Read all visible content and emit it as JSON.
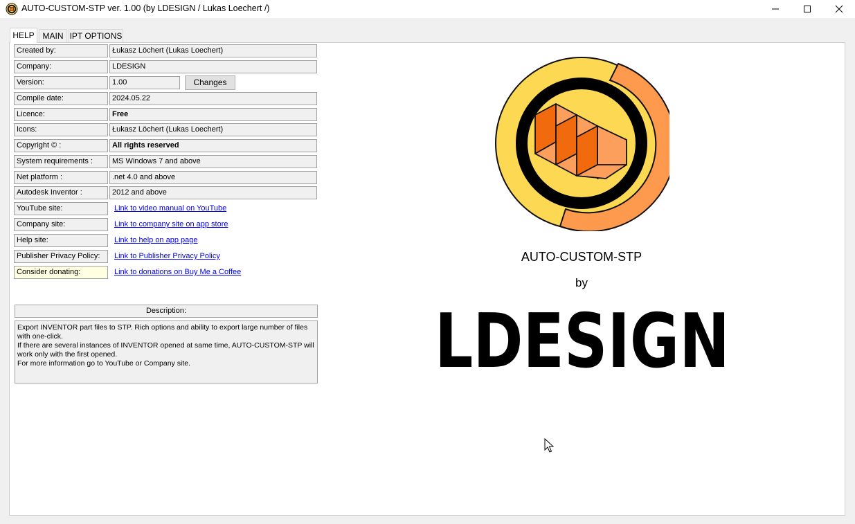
{
  "window": {
    "title": "AUTO-CUSTOM-STP ver. 1.00 (by LDESIGN / Lukas Loechert /)"
  },
  "tabs": [
    {
      "label": "HELP",
      "active": true
    },
    {
      "label": "MAIN",
      "active": false
    },
    {
      "label": "IPT OPTIONS",
      "active": false
    }
  ],
  "info": {
    "created_by": {
      "label": "Created by:",
      "value": "Łukasz Löchert (Lukas Loechert)"
    },
    "company": {
      "label": "Company:",
      "value": "LDESIGN"
    },
    "version": {
      "label": "Version:",
      "value": "1.00",
      "button": "Changes"
    },
    "compile_date": {
      "label": "Compile date:",
      "value": "2024.05.22"
    },
    "licence": {
      "label": "Licence:",
      "value": "Free"
    },
    "icons": {
      "label": "Icons:",
      "value": "Łukasz Löchert (Lukas Loechert)"
    },
    "copyright": {
      "label": "Copyright © :",
      "value": "All rights reserved"
    },
    "system_requirements": {
      "label": "System requirements :",
      "value": "MS Windows 7 and above"
    },
    "net_platform": {
      "label": "Net platform :",
      "value": ".net 4.0 and above"
    },
    "autodesk_inventor": {
      "label": "Autodesk Inventor :",
      "value": "2012 and above"
    }
  },
  "links": {
    "youtube": {
      "label": "YouTube site:",
      "text": "Link to video manual on YouTube"
    },
    "company_site": {
      "label": "Company site:",
      "text": "Link to company site on app store"
    },
    "help_site": {
      "label": "Help site:",
      "text": "Link to help on app page"
    },
    "privacy": {
      "label": "Publisher Privacy Policy:",
      "text": "Link to Publisher Privacy Policy"
    },
    "donate": {
      "label": "Consider donating:",
      "text": "Link to donations on Buy Me a Coffee"
    }
  },
  "description": {
    "header": "Description:",
    "lines": [
      "Export INVENTOR part files to STP. Rich options and ability to export large number of files with one-click.",
      "If there are several instances of INVENTOR opened at same time, AUTO-CUSTOM-STP will work only with the first opened.",
      "For more information go to YouTube or Company site."
    ]
  },
  "branding": {
    "product_name": "AUTO-CUSTOM-STP",
    "by": "by",
    "company": "LDESIGN"
  },
  "colors": {
    "logo_yellow": "#fcd853",
    "logo_orange": "#fd9a4d",
    "logo_dark_orange": "#f26a0e",
    "logo_light_orange": "#fc9f5d",
    "link": "#0000ee",
    "highlight": "#ffffe1"
  },
  "icons": {
    "app": "app-logo-icon",
    "minimize": "minimize-icon",
    "maximize": "maximize-icon",
    "close": "close-icon",
    "cursor": "mouse-pointer-icon"
  }
}
